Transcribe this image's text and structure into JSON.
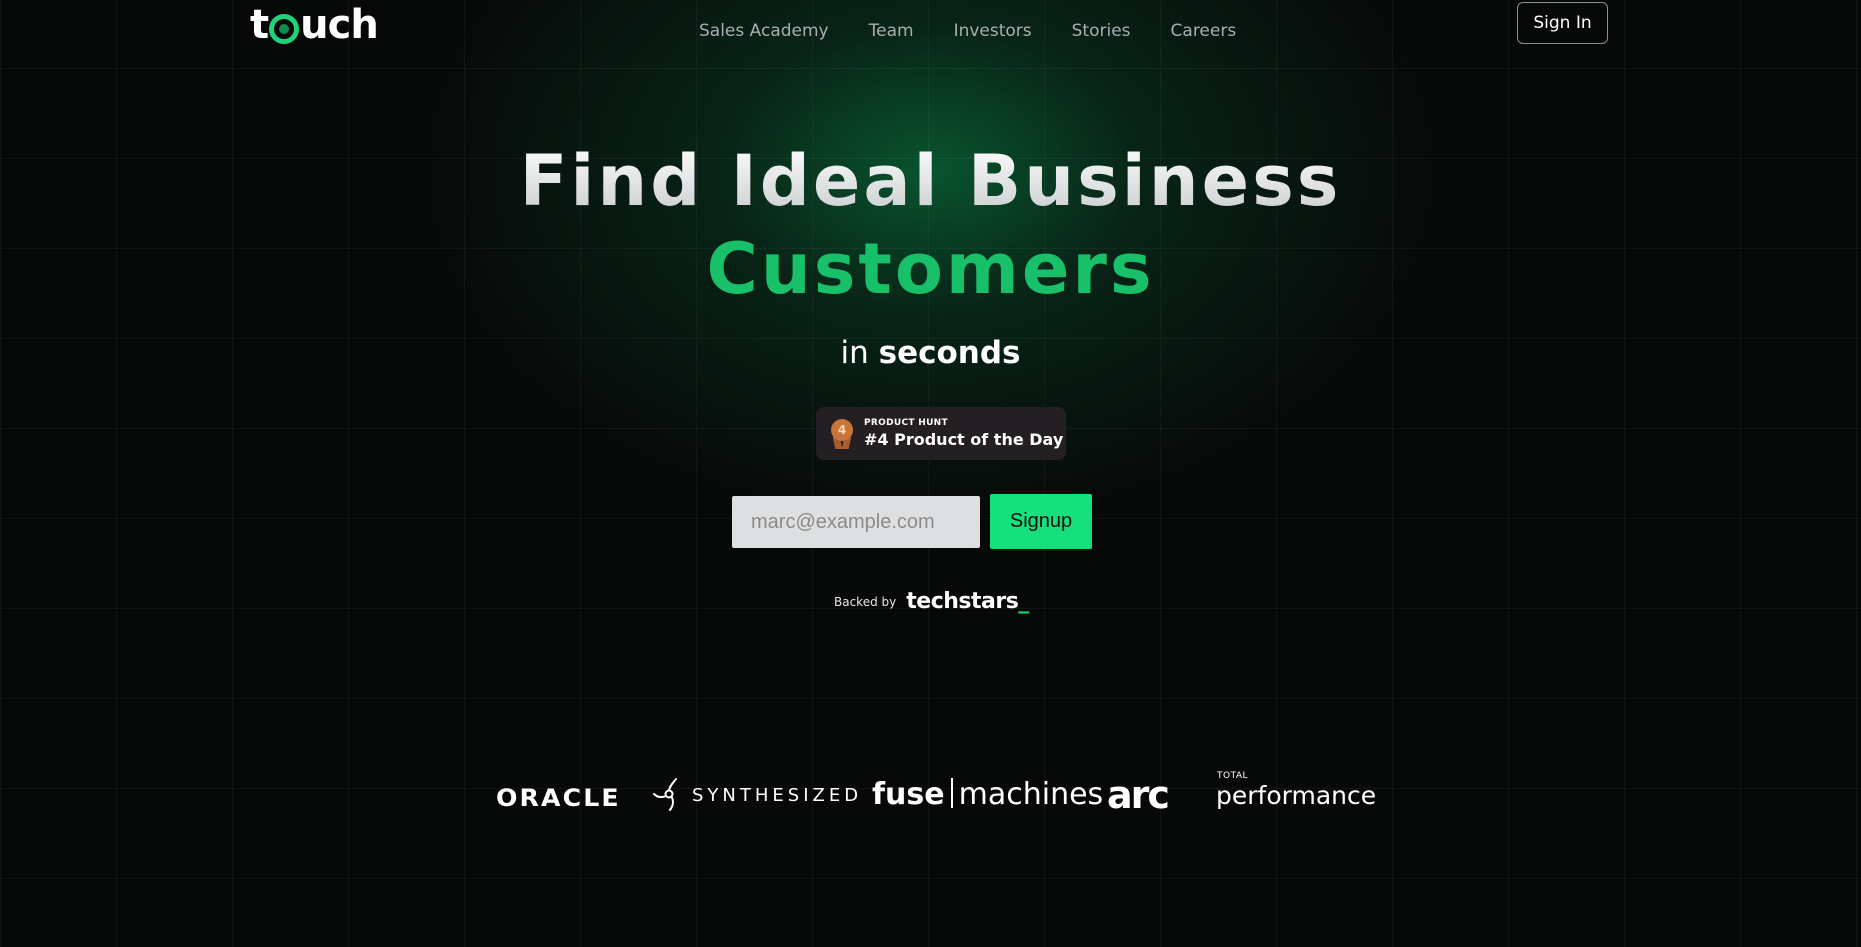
{
  "header": {
    "logo_prefix": "t",
    "logo_suffix": "uch",
    "nav": [
      {
        "label": "Sales Academy"
      },
      {
        "label": "Team"
      },
      {
        "label": "Investors"
      },
      {
        "label": "Stories"
      },
      {
        "label": "Careers"
      }
    ],
    "signin_label": "Sign In"
  },
  "hero": {
    "headline_line1": "Find Ideal Business",
    "headline_line2": "Customers",
    "sub_prefix": "in",
    "sub_emphasis": "seconds",
    "badge": {
      "rank": "4",
      "kicker": "PRODUCT HUNT",
      "title": "#4 Product of the Day"
    },
    "email_placeholder": "marc@example.com",
    "signup_label": "Signup",
    "backed_label": "Backed by",
    "backer_name": "techstars",
    "backer_suffix": "_"
  },
  "partners": {
    "oracle": "ORACLE",
    "synthesized": "SYNTHESIZED",
    "fuse_bold": "fuse",
    "fuse_thin": "machines",
    "arc": "arc",
    "total": "TOTAL",
    "performance": "performance"
  },
  "colors": {
    "accent": "#19c06a",
    "button": "#16e07e",
    "background": "#070808"
  }
}
